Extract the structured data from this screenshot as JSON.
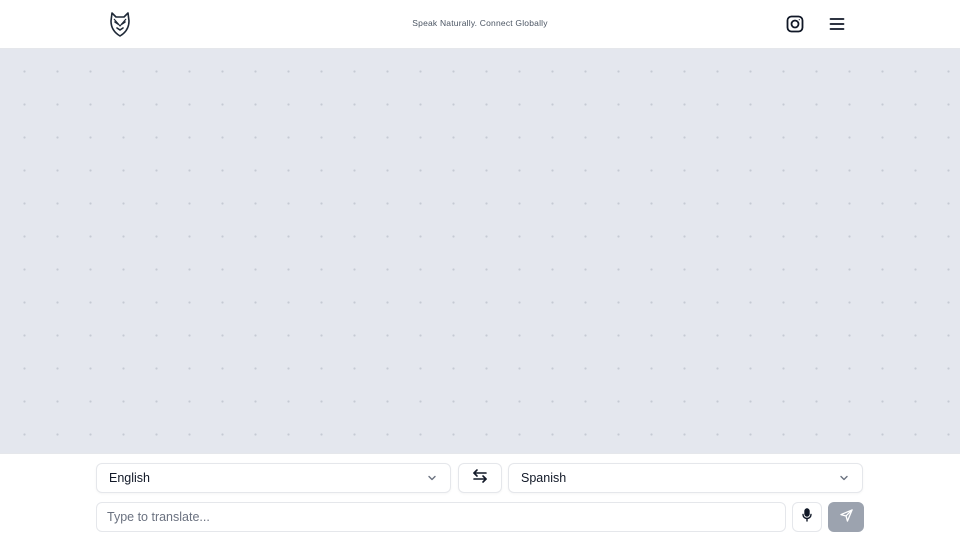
{
  "header": {
    "tagline": "Speak Naturally. Connect Globally",
    "logo_icon": "fox-shield-icon",
    "instagram_icon": "instagram-icon",
    "menu_icon": "hamburger-menu-icon"
  },
  "controls": {
    "source_language": "English",
    "target_language": "Spanish",
    "swap_icon": "swap-arrows-icon",
    "input_placeholder": "Type to translate...",
    "input_value": "",
    "mic_icon": "microphone-icon",
    "send_icon": "send-icon"
  },
  "colors": {
    "chat_background": "#e4e7ee",
    "send_button": "#9ca3af",
    "border": "#e5e7eb"
  }
}
